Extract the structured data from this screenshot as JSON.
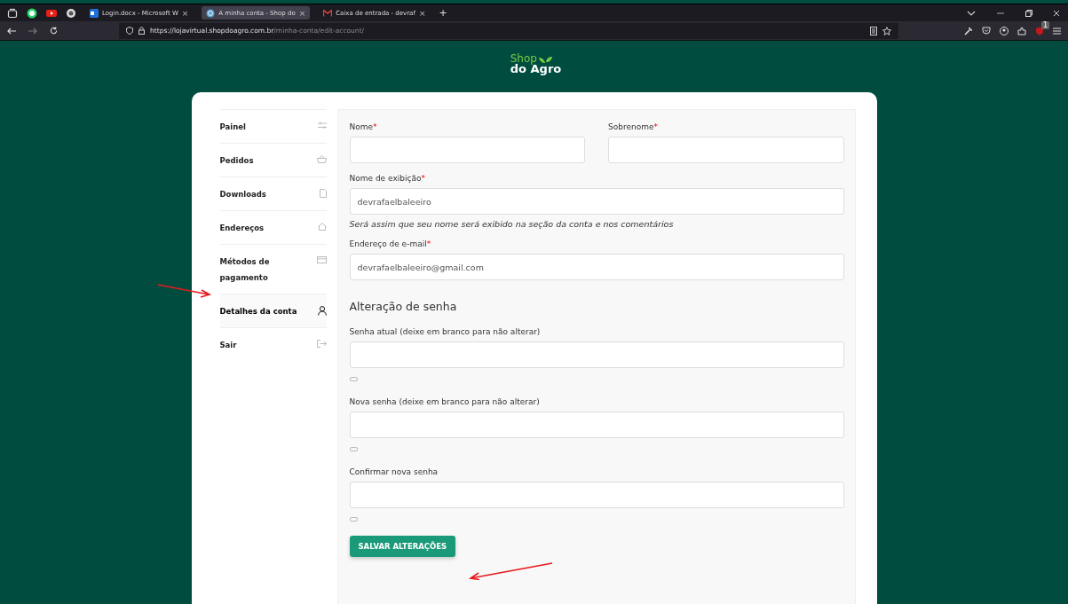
{
  "browser": {
    "tabs": [
      {
        "title": "Login.docx - Microsoft W",
        "close": "×",
        "selected": false
      },
      {
        "title": "A minha conta - Shop do",
        "close": "×",
        "selected": true
      },
      {
        "title": "Caixa de entrada - devraf",
        "close": "×",
        "selected": false
      }
    ],
    "new_tab": "+",
    "url_host": "https://lojavirtual.shopdoagro.com.br",
    "url_path": "/minha-conta/edit-account/",
    "extension_badge": "1"
  },
  "logo": {
    "line_1": "Shop",
    "line_2": "do Agro"
  },
  "sidebar": {
    "items": [
      {
        "label": "Painel",
        "selected": false
      },
      {
        "label": "Pedidos",
        "selected": false
      },
      {
        "label": "Downloads",
        "selected": false
      },
      {
        "label": "Endereços",
        "selected": false
      },
      {
        "label": "Métodos de pagamento",
        "selected": false
      },
      {
        "label": "Detalhes da conta",
        "selected": true
      },
      {
        "label": "Sair",
        "selected": false
      }
    ]
  },
  "form": {
    "required_mark": "*",
    "rows": [
      {
        "fields": [
          {
            "label": "Nome",
            "required": true
          },
          {
            "label": "Sobrenome",
            "required": true
          }
        ]
      },
      {
        "fields": [
          {
            "label": "Nome de exibição",
            "required": true,
            "value": "devrafaelbaleeiro",
            "hint": "Será assim que seu nome será exibido na seção da conta e nos comentários"
          }
        ]
      },
      {
        "fields": [
          {
            "label": "Endereço de e-mail",
            "required": true,
            "value": "devrafaelbaleeiro@gmail.com"
          }
        ]
      }
    ],
    "password_section": {
      "title": "Alteração de senha",
      "fields": [
        {
          "label": "Senha atual (deixe em branco para não alterar)"
        },
        {
          "label": "Nova senha (deixe em branco para não alterar)"
        },
        {
          "label": "Confirmar nova senha"
        }
      ]
    },
    "submit": "SALVAR ALTERAÇÕES"
  }
}
